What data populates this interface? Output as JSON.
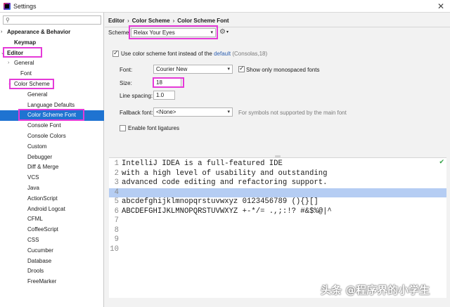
{
  "window": {
    "title": "Settings",
    "close": "✕"
  },
  "search": {
    "placeholder": ""
  },
  "sidebar": {
    "items": [
      {
        "label": "Appearance & Behavior",
        "arrow": "›",
        "indent": 8,
        "bold": true
      },
      {
        "label": "Keymap",
        "arrow": "",
        "indent": 18,
        "bold": true
      },
      {
        "label": "Editor",
        "arrow": "⌄",
        "indent": 8,
        "bold": true
      },
      {
        "label": "General",
        "arrow": "›",
        "indent": 18,
        "bold": false
      },
      {
        "label": "Font",
        "arrow": "",
        "indent": 27,
        "bold": false
      },
      {
        "label": "Color Scheme",
        "arrow": "⌄",
        "indent": 18,
        "bold": false
      },
      {
        "label": "General",
        "arrow": "",
        "indent": 37,
        "bold": false
      },
      {
        "label": "Language Defaults",
        "arrow": "",
        "indent": 37,
        "bold": false
      },
      {
        "label": "Color Scheme Font",
        "arrow": "",
        "indent": 37,
        "bold": false,
        "selected": true
      },
      {
        "label": "Console Font",
        "arrow": "",
        "indent": 37,
        "bold": false
      },
      {
        "label": "Console Colors",
        "arrow": "",
        "indent": 37,
        "bold": false
      },
      {
        "label": "Custom",
        "arrow": "",
        "indent": 37,
        "bold": false
      },
      {
        "label": "Debugger",
        "arrow": "",
        "indent": 37,
        "bold": false
      },
      {
        "label": "Diff & Merge",
        "arrow": "",
        "indent": 37,
        "bold": false
      },
      {
        "label": "VCS",
        "arrow": "",
        "indent": 37,
        "bold": false
      },
      {
        "label": "Java",
        "arrow": "",
        "indent": 37,
        "bold": false
      },
      {
        "label": "ActionScript",
        "arrow": "",
        "indent": 37,
        "bold": false
      },
      {
        "label": "Android Logcat",
        "arrow": "",
        "indent": 37,
        "bold": false
      },
      {
        "label": "CFML",
        "arrow": "",
        "indent": 37,
        "bold": false
      },
      {
        "label": "CoffeeScript",
        "arrow": "",
        "indent": 37,
        "bold": false
      },
      {
        "label": "CSS",
        "arrow": "",
        "indent": 37,
        "bold": false
      },
      {
        "label": "Cucumber",
        "arrow": "",
        "indent": 37,
        "bold": false
      },
      {
        "label": "Database",
        "arrow": "",
        "indent": 37,
        "bold": false
      },
      {
        "label": "Drools",
        "arrow": "",
        "indent": 37,
        "bold": false
      },
      {
        "label": "FreeMarker",
        "arrow": "",
        "indent": 37,
        "bold": false
      }
    ]
  },
  "breadcrumb": {
    "part1": "Editor",
    "part2": "Color Scheme",
    "part3": "Color Scheme Font",
    "sep": "›"
  },
  "scheme": {
    "label": "Scheme:",
    "value": "Relax Your Eyes"
  },
  "use_scheme_font": {
    "checked": true,
    "text_before": "Use color scheme font instead of the",
    "link": "default",
    "text_after": "(Consolas,18)"
  },
  "font": {
    "label": "Font:",
    "value": "Courier New"
  },
  "monospaced": {
    "label": "Show only monospaced fonts",
    "checked": true
  },
  "size": {
    "label": "Size:",
    "value": "18"
  },
  "line_spacing": {
    "label": "Line spacing:",
    "value": "1.0"
  },
  "fallback": {
    "label": "Fallback font:",
    "value": "<None>",
    "hint": "For symbols not supported by the main font"
  },
  "ligatures": {
    "label": "Enable font ligatures",
    "checked": false
  },
  "preview": {
    "lines": [
      {
        "n": "1",
        "text": "IntelliJ IDEA is a full-featured IDE"
      },
      {
        "n": "2",
        "text": "with a high level of usability and outstanding"
      },
      {
        "n": "3",
        "text": "advanced code editing and refactoring support."
      },
      {
        "n": "4",
        "text": "",
        "current": true
      },
      {
        "n": "5",
        "text": "abcdefghijklmnopqrstuvwxyz 0123456789 (){}[]"
      },
      {
        "n": "6",
        "text": "ABCDEFGHIJKLMNOPQRSTUVWXYZ +-*/= .,;:!? #&$%@|^"
      },
      {
        "n": "7",
        "text": ""
      },
      {
        "n": "8",
        "text": ""
      },
      {
        "n": "9",
        "text": ""
      },
      {
        "n": "10",
        "text": ""
      }
    ]
  },
  "watermark": "头条 @程序界的小学生",
  "colors": {
    "accent": "#1f73d1",
    "highlight": "#e53ad8",
    "current_line": "#b5cdf3"
  }
}
